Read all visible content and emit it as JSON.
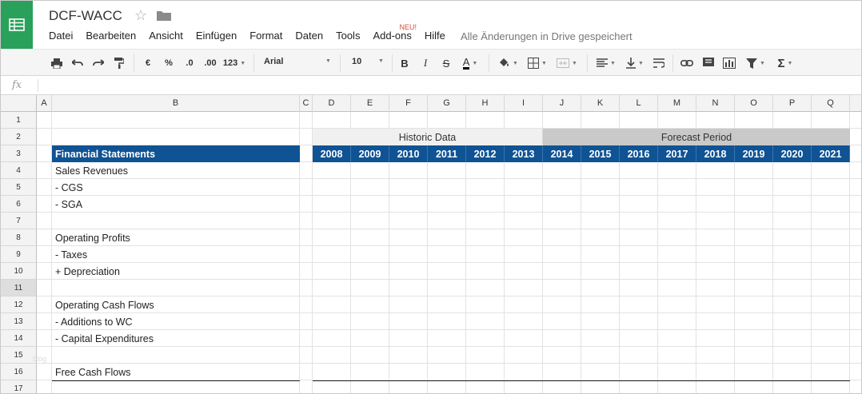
{
  "document": {
    "title": "DCF-WACC",
    "saved_status": "Alle Änderungen in Drive gespeichert"
  },
  "menu": {
    "items": [
      "Datei",
      "Bearbeiten",
      "Ansicht",
      "Einfügen",
      "Format",
      "Daten",
      "Tools",
      "Add-ons",
      "Hilfe"
    ],
    "new_badge": "NEU!"
  },
  "toolbar": {
    "currency": "€",
    "percent": "%",
    "dec_less": ".0",
    "dec_more": ".00",
    "number_format": "123",
    "font": "Arial",
    "font_size": "10",
    "bold": "B",
    "italic": "I",
    "strike": "S",
    "text_color": "A",
    "sum": "Σ"
  },
  "formula_bar": {
    "fx_label": "fx",
    "value": ""
  },
  "sheet": {
    "column_headers": [
      "A",
      "B",
      "C",
      "D",
      "E",
      "F",
      "G",
      "H",
      "I",
      "J",
      "K",
      "L",
      "M",
      "N",
      "O",
      "P",
      "Q"
    ],
    "row_numbers": [
      "1",
      "2",
      "3",
      "4",
      "5",
      "6",
      "7",
      "8",
      "9",
      "10",
      "11",
      "12",
      "13",
      "14",
      "15",
      "16",
      "17"
    ],
    "selected_row": "11",
    "historic_label": "Historic Data",
    "forecast_label": "Forecast Period",
    "header_label": "Financial Statements",
    "years": [
      "2008",
      "2009",
      "2010",
      "2011",
      "2012",
      "2013",
      "2014",
      "2015",
      "2016",
      "2017",
      "2018",
      "2019",
      "2020",
      "2021"
    ],
    "row_labels": [
      {
        "row": "4",
        "text": "Sales Revenues"
      },
      {
        "row": "5",
        "text": "- CGS"
      },
      {
        "row": "6",
        "text": "- SGA"
      },
      {
        "row": "8",
        "text": "Operating Profits"
      },
      {
        "row": "9",
        "text": "- Taxes"
      },
      {
        "row": "10",
        "text": "+ Depreciation"
      },
      {
        "row": "12",
        "text": "Operating Cash Flows"
      },
      {
        "row": "13",
        "text": "- Additions to WC"
      },
      {
        "row": "14",
        "text": "- Capital Expenditures"
      },
      {
        "row": "16",
        "text": "Free Cash Flows"
      }
    ],
    "watermark": "blog",
    "colors": {
      "header_blue": "#0f5394",
      "historic_gray": "#f0f0f0",
      "forecast_gray": "#c9c9c9",
      "logo_green": "#2aa15b"
    }
  }
}
